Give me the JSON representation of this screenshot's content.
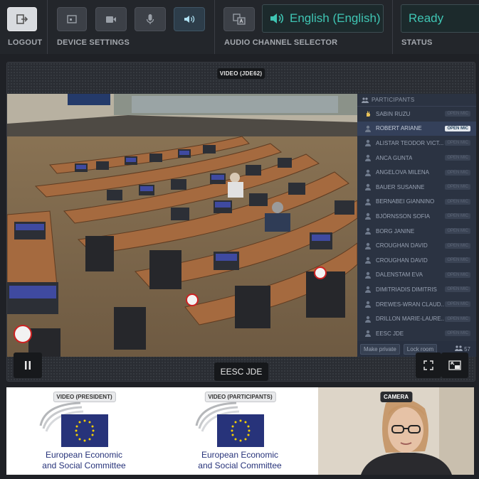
{
  "toolbar": {
    "logout_label": "LOGOUT",
    "device_settings_label": "DEVICE SETTINGS",
    "audio_channel_label": "AUDIO CHANNEL SELECTOR",
    "status_label": "STATUS",
    "language": "English (English)",
    "status": "Ready"
  },
  "main_video": {
    "tag": "VIDEO (JDE62)",
    "room_name": "EESC JDE"
  },
  "participants": {
    "header": "PARTICIPANTS",
    "items": [
      {
        "name": "SABIN RUZU",
        "mic": "OPEN MIC",
        "selected": false
      },
      {
        "name": "ROBERT ARIANE",
        "mic": "OPEN MIC",
        "selected": true
      },
      {
        "name": "ALISTAR TEODOR VICT...",
        "mic": "OPEN MIC",
        "selected": false
      },
      {
        "name": "ANCA GUNTA",
        "mic": "OPEN MIC",
        "selected": false
      },
      {
        "name": "ANGELOVA MILENA",
        "mic": "OPEN MIC",
        "selected": false
      },
      {
        "name": "BAUER SUSANNE",
        "mic": "OPEN MIC",
        "selected": false
      },
      {
        "name": "BERNABEI GIANNINO",
        "mic": "OPEN MIC",
        "selected": false
      },
      {
        "name": "BJÖRNSSON SOFIA",
        "mic": "OPEN MIC",
        "selected": false
      },
      {
        "name": "BORG JANINE",
        "mic": "OPEN MIC",
        "selected": false
      },
      {
        "name": "CROUGHAN DAVID",
        "mic": "OPEN MIC",
        "selected": false
      },
      {
        "name": "CROUGHAN DAVID",
        "mic": "OPEN MIC",
        "selected": false
      },
      {
        "name": "DALENSTAM EVA",
        "mic": "OPEN MIC",
        "selected": false
      },
      {
        "name": "DIMITRIADIS DIMITRIS",
        "mic": "OPEN MIC",
        "selected": false
      },
      {
        "name": "DREWES-WRAN CLAUD...",
        "mic": "OPEN MIC",
        "selected": false
      },
      {
        "name": "DRILLON MARIE-LAURE...",
        "mic": "OPEN MIC",
        "selected": false
      },
      {
        "name": "EESC JDE",
        "mic": "OPEN MIC",
        "selected": false
      }
    ],
    "make_private": "Make private",
    "lock_room": "Lock room",
    "count": "57"
  },
  "thumbnails": [
    {
      "tag": "VIDEO (PRESIDENT)",
      "org_line1": "European Economic",
      "org_line2": "and Social Committee"
    },
    {
      "tag": "VIDEO (PARTICIPANTS)",
      "org_line1": "European Economic",
      "org_line2": "and Social Committee"
    },
    {
      "tag": "CAMERA"
    }
  ],
  "colors": {
    "accent": "#3fc5b3",
    "eu_blue": "#27337a",
    "eu_star": "#f5d000"
  },
  "icons": [
    "logout-icon",
    "settings-window-icon",
    "camera-icon",
    "microphone-icon",
    "speaker-icon",
    "translate-icon",
    "pause-icon",
    "fullscreen-icon",
    "pip-icon",
    "user-icon",
    "users-icon"
  ]
}
